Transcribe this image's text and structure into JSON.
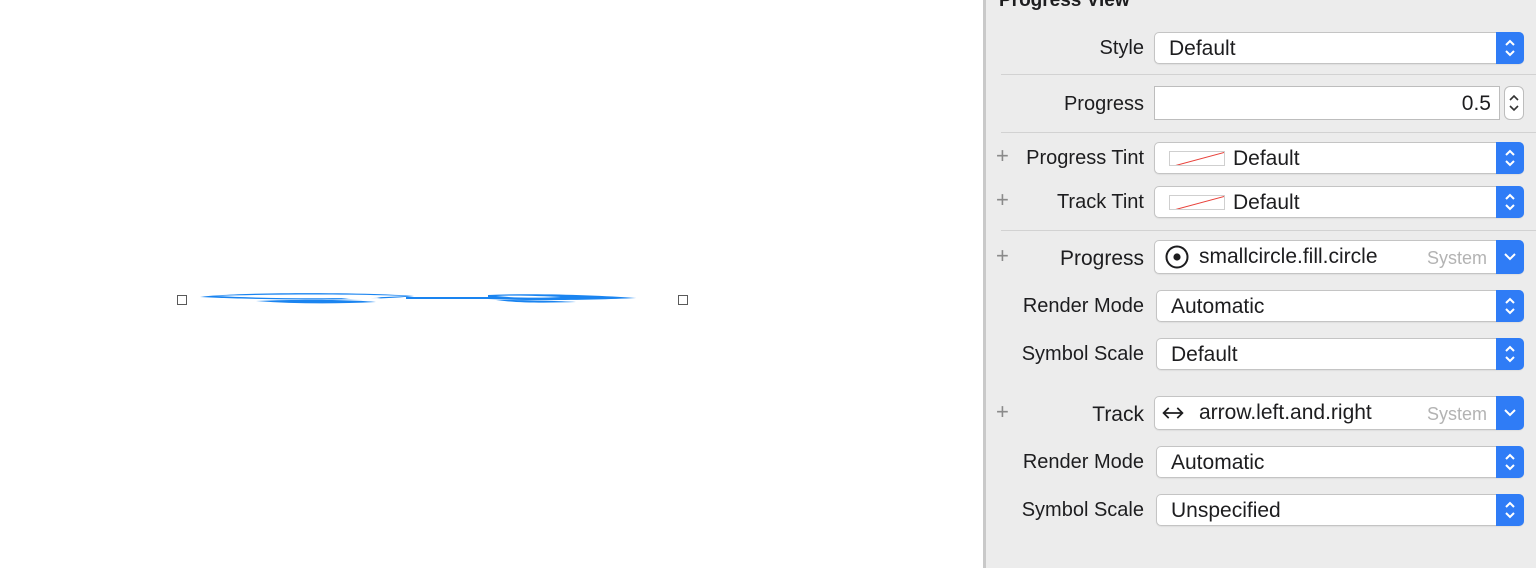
{
  "inspector": {
    "section_title": "Progress View",
    "style_label": "Style",
    "style_value": "Default",
    "progress_label": "Progress",
    "progress_value": "0.5",
    "progress_tint_label": "Progress Tint",
    "progress_tint_value": "Default",
    "track_tint_label": "Track Tint",
    "track_tint_value": "Default",
    "progress_image_label": "Progress",
    "progress_image_value": "smallcircle.fill.circle",
    "progress_image_tag": "System",
    "progress_render_mode_label": "Render Mode",
    "progress_render_mode_value": "Automatic",
    "progress_symbol_scale_label": "Symbol Scale",
    "progress_symbol_scale_value": "Default",
    "track_image_label": "Track",
    "track_image_value": "arrow.left.and.right",
    "track_image_tag": "System",
    "track_render_mode_label": "Render Mode",
    "track_render_mode_value": "Automatic",
    "track_symbol_scale_label": "Symbol Scale",
    "track_symbol_scale_value": "Unspecified",
    "plus_glyph": "+"
  },
  "icons": {
    "progress_symbol": "smallcircle-fill-circle-icon",
    "track_symbol": "arrow-left-and-right-icon",
    "popup_arrows": "up-down-chevron-icon",
    "pulldown_arrow": "chevron-down-icon",
    "no_color_swatch": "no-color-swatch-icon"
  },
  "colors": {
    "accent": "#2f7cf6",
    "progress_glyph": "#1a84f0",
    "inspector_bg": "#ececec",
    "no_color_line": "#e8413a"
  }
}
